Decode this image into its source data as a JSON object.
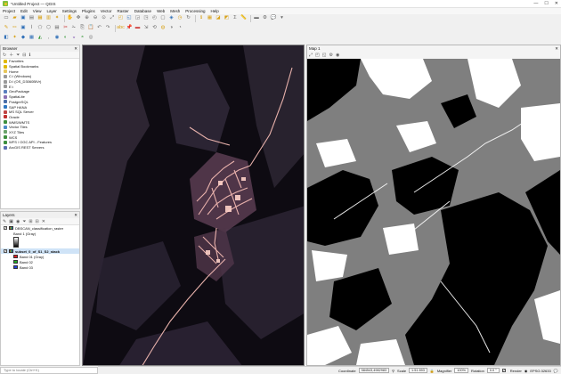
{
  "window": {
    "title": "*Untitled Project — QGIS",
    "controls": [
      "—",
      "☐",
      "✕"
    ]
  },
  "menu": [
    "Project",
    "Edit",
    "View",
    "Layer",
    "Settings",
    "Plugins",
    "Vector",
    "Raster",
    "Database",
    "Web",
    "Mesh",
    "Processing",
    "Help"
  ],
  "browser": {
    "title": "Browser",
    "items": [
      {
        "label": "Favorites",
        "color": "#e0b800"
      },
      {
        "label": "Spatial Bookmarks",
        "color": "#e0b800"
      },
      {
        "label": "Home",
        "color": "#e8c75a"
      },
      {
        "label": "C:\\ (Windows)",
        "color": "#999999"
      },
      {
        "label": "D:\\ (OS_D3060BIVr)",
        "color": "#999999"
      },
      {
        "label": "E:\\",
        "color": "#999999"
      },
      {
        "label": "GeoPackage",
        "color": "#5a7fbf"
      },
      {
        "label": "SpatiaLite",
        "color": "#8a6fb3"
      },
      {
        "label": "PostgreSQL",
        "color": "#4a6ea8"
      },
      {
        "label": "SAP HANA",
        "color": "#2f77c0"
      },
      {
        "label": "MS SQL Server",
        "color": "#c04444"
      },
      {
        "label": "Oracle",
        "color": "#c03030"
      },
      {
        "label": "WMS/WMTS",
        "color": "#3d8f3d"
      },
      {
        "label": "Vector Tiles",
        "color": "#4c8ac6"
      },
      {
        "label": "XYZ Tiles",
        "color": "#6aa36a"
      },
      {
        "label": "WCS",
        "color": "#3d8f3d"
      },
      {
        "label": "WFS / OGC API - Features",
        "color": "#3d8f3d"
      },
      {
        "label": "ArcGIS REST Servers",
        "color": "#5b6fb0"
      }
    ]
  },
  "layers": {
    "title": "Layers",
    "rows": [
      {
        "label": "DBSCAN_classification_raster",
        "checked": "✓",
        "kind": "layer"
      },
      {
        "label": "Band 1 (Gray)",
        "kind": "sub"
      },
      {
        "label": "",
        "kind": "gradient"
      },
      {
        "label": "subset_0_of_S1_S2_stack",
        "checked": "✓",
        "kind": "layer-selected"
      },
      {
        "label": "Band 01 (Gray)",
        "kind": "band",
        "color": "#e02020"
      },
      {
        "label": "Band 02",
        "kind": "band",
        "color": "#20b020"
      },
      {
        "label": "Band 03",
        "kind": "band",
        "color": "#2040e0"
      }
    ]
  },
  "map2": {
    "title": "Map 1"
  },
  "search": {
    "placeholder": "Type to locate (Ctrl+K)"
  },
  "status": {
    "coordinate_label": "Coordinate",
    "coordinate": "584543,4982983",
    "scale_label": "Scale",
    "scale": "1:51 893",
    "magnifier_label": "Magnifier",
    "magnifier": "100%",
    "rotation_label": "Rotation",
    "rotation": "0.0 °",
    "render_label": "Render",
    "crs": "EPSG:32633"
  }
}
